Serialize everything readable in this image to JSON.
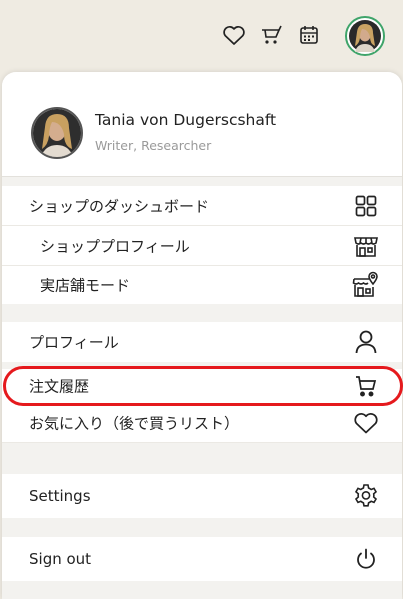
{
  "topbar": {
    "icons": [
      "heart-icon",
      "cart-icon",
      "calendar-icon",
      "avatar"
    ]
  },
  "user": {
    "name": "Tania von Dugerscshaft",
    "role": "Writer, Researcher"
  },
  "menu": {
    "shop_dashboard": "ショップのダッシュボード",
    "shop_profile": "ショッププロフィール",
    "physical_store_mode": "実店舗モード",
    "profile": "プロフィール",
    "order_history": "注文履歴",
    "favorites": "お気に入り（後で買うリスト）",
    "settings": "Settings",
    "sign_out": "Sign out"
  },
  "colors": {
    "highlight": "#e5191d",
    "avatar_ring": "#3fa46a",
    "background": "#efebe2"
  }
}
